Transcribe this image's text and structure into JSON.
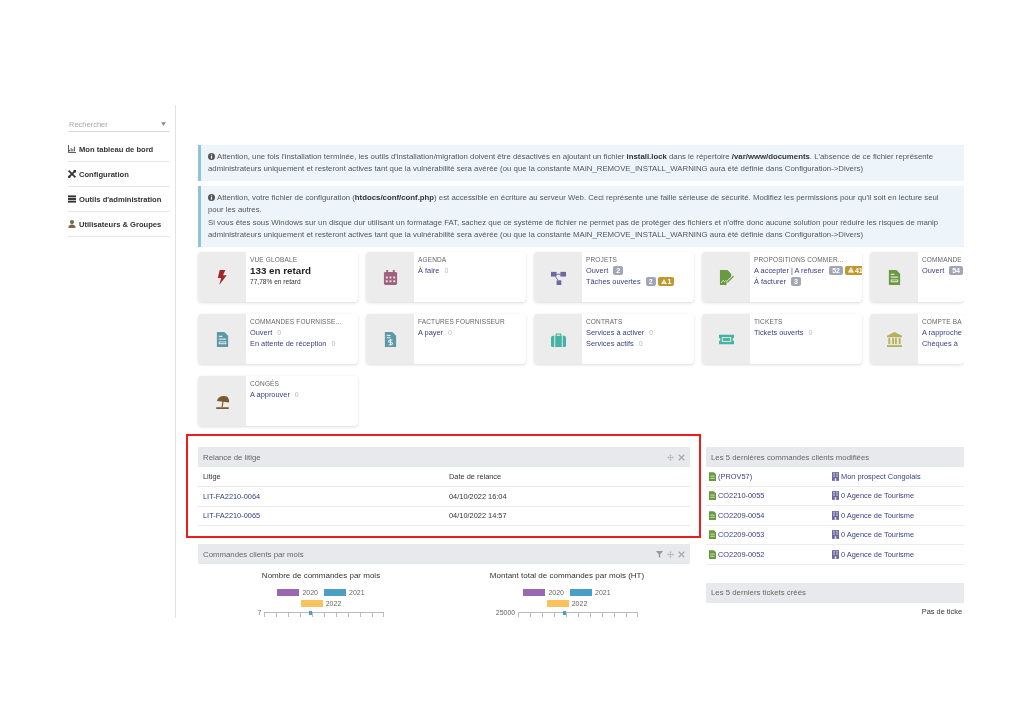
{
  "sidebar": {
    "search": {
      "placeholder": "Rechercher"
    },
    "items": [
      {
        "kind": "dashboard",
        "label": "Mon tableau de bord"
      },
      {
        "kind": "setup",
        "label": "Configuration"
      },
      {
        "kind": "tools",
        "label": "Outils d'administration"
      },
      {
        "kind": "users",
        "label": "Utilisateurs & Groupes"
      }
    ]
  },
  "warnings": [
    {
      "lines": [
        "Attention, une fois l'installation terminée, les outils d'installation/migration doivent être désactivés en ajoutant un fichier **install.lock** dans le répertoire **/var/www/documents**. L'absence de ce fichier représente",
        "administrateurs uniquement et resteront actives tant que la vulnérabilité sera avérée (ou que la constante MAIN_REMOVE_INSTALL_WARNING aura été définie dans Configuration->Divers)"
      ]
    },
    {
      "lines": [
        "Attention, votre fichier de configuration (**htdocs/conf/conf.php**) est accessible en écriture au serveur Web. Ceci représente une faille sérieuse de sécurité. Modifiez les permissions pour qu'il soit en lecture seul",
        "pour les autres.",
        "Si vous êtes sous Windows sur un disque dur utilisant un formatage FAT, sachez que ce système de fichier ne permet pas de protéger des fichiers et n'offre donc aucune solution pour réduire les risques de manip",
        "administrateurs uniquement et resteront actives tant que la vulnérabilité sera avérée (ou que la constante MAIN_REMOVE_INSTALL_WARNING aura été définie dans Configuration->Divers)"
      ]
    }
  ],
  "cards": [
    {
      "kind": "overview",
      "title": "VUE GLOBALE",
      "color": "#a3262a",
      "headline": "133 en retard",
      "subline": "77,78% en retard"
    },
    {
      "kind": "agenda",
      "title": "AGENDA",
      "color": "#a0607e",
      "lines": [
        {
          "label": "À faire",
          "badges": [
            {
              "kind": "plain",
              "text": "0"
            }
          ]
        }
      ]
    },
    {
      "kind": "projects",
      "title": "PROJETS",
      "color": "#6b6a9e",
      "lines": [
        {
          "label": "Ouvert",
          "badges": [
            {
              "kind": "count",
              "text": "2"
            }
          ]
        },
        {
          "label": "Tâches ouvertes",
          "badges": [
            {
              "kind": "count",
              "text": "2"
            },
            {
              "kind": "warning",
              "text": "1"
            }
          ]
        }
      ]
    },
    {
      "kind": "proposals",
      "title": "PROPOSITIONS COMMER...",
      "color": "#6a9a40",
      "lines": [
        {
          "label": "A accepter | A refuser",
          "badges": [
            {
              "kind": "count",
              "text": "52"
            },
            {
              "kind": "warning",
              "text": "41"
            }
          ]
        },
        {
          "label": "À facturer",
          "badges": [
            {
              "kind": "count",
              "text": "3"
            }
          ]
        }
      ]
    },
    {
      "kind": "customer_orders",
      "title": "COMMANDE",
      "color": "#6a9a40",
      "lines": [
        {
          "label": "Ouvert",
          "badges": [
            {
              "kind": "count",
              "text": "54"
            }
          ]
        }
      ]
    },
    {
      "kind": "supplier_orders",
      "title": "COMMANDES FOURNISSE...",
      "color": "#5a98aa",
      "lines": [
        {
          "label": "Ouvert",
          "badges": [
            {
              "kind": "plain",
              "text": "0"
            }
          ]
        },
        {
          "label": "En attente de réception",
          "badges": [
            {
              "kind": "plain",
              "text": "0"
            }
          ]
        }
      ]
    },
    {
      "kind": "supplier_invoices",
      "title": "FACTURES FOURNISSEUR",
      "color": "#5a98aa",
      "lines": [
        {
          "label": "A payer",
          "badges": [
            {
              "kind": "plain",
              "text": "0"
            }
          ]
        }
      ]
    },
    {
      "kind": "contracts",
      "title": "CONTRATS",
      "color": "#45b3a4",
      "lines": [
        {
          "label": "Services à activer",
          "badges": [
            {
              "kind": "plain",
              "text": "0"
            }
          ]
        },
        {
          "label": "Services actifs",
          "badges": [
            {
              "kind": "plain",
              "text": "0"
            }
          ]
        }
      ]
    },
    {
      "kind": "tickets",
      "title": "TICKETS",
      "color": "#45b3a4",
      "lines": [
        {
          "label": "Tickets ouverts",
          "badges": [
            {
              "kind": "plain",
              "text": "0"
            }
          ]
        }
      ]
    },
    {
      "kind": "bank",
      "title": "COMPTE BA",
      "color": "#b3b35a",
      "lines": [
        {
          "label": "A rapproche"
        },
        {
          "label": "Chèques à"
        }
      ]
    },
    {
      "kind": "holidays",
      "title": "CONGÉS",
      "color": "#7a5a2e",
      "lines": [
        {
          "label": "A approuver",
          "badges": [
            {
              "kind": "plain",
              "text": "0"
            }
          ]
        }
      ]
    }
  ],
  "litige_panel": {
    "title": "Relance de litige",
    "highlighted": true,
    "columns": [
      "Litige",
      "Date de relance"
    ],
    "rows": [
      [
        "LIT-FA2210-0064",
        "04/10/2022 16:04"
      ],
      [
        "LIT-FA2210-0065",
        "04/10/2022 14:57"
      ]
    ]
  },
  "orders_chart_panel": {
    "title": "Commandes clients par mois",
    "charts": [
      {
        "title": "Nombre de commandes par mois",
        "legend": [
          {
            "name": "2020",
            "color": "#9b67b0"
          },
          {
            "name": "2021",
            "color": "#4a9fc4"
          },
          {
            "name": "2022",
            "color": "#f9c25d"
          }
        ],
        "top_tick": "7"
      },
      {
        "title": "Montant total de commandes par mois (HT)",
        "legend": [
          {
            "name": "2020",
            "color": "#9b67b0"
          },
          {
            "name": "2021",
            "color": "#4a9fc4"
          },
          {
            "name": "2022",
            "color": "#f9c25d"
          }
        ],
        "top_tick": "25000"
      }
    ]
  },
  "recent_orders_panel": {
    "title": "Les 5 dernières commandes clients modifiées",
    "rows": [
      {
        "ref": "(PROV57)",
        "customer": "Mon prospect Congolais"
      },
      {
        "ref": "CO2210-0055",
        "customer": "0 Agence de Tourisme"
      },
      {
        "ref": "CO2209-0054",
        "customer": "0 Agence de Tourisme"
      },
      {
        "ref": "CO2209-0053",
        "customer": "0 Agence de Tourisme"
      },
      {
        "ref": "CO2209-0052",
        "customer": "0 Agence de Tourisme"
      }
    ]
  },
  "recent_tickets_panel": {
    "title": "Les 5 derniers tickets créés",
    "empty_text": "Pas de ticke"
  }
}
